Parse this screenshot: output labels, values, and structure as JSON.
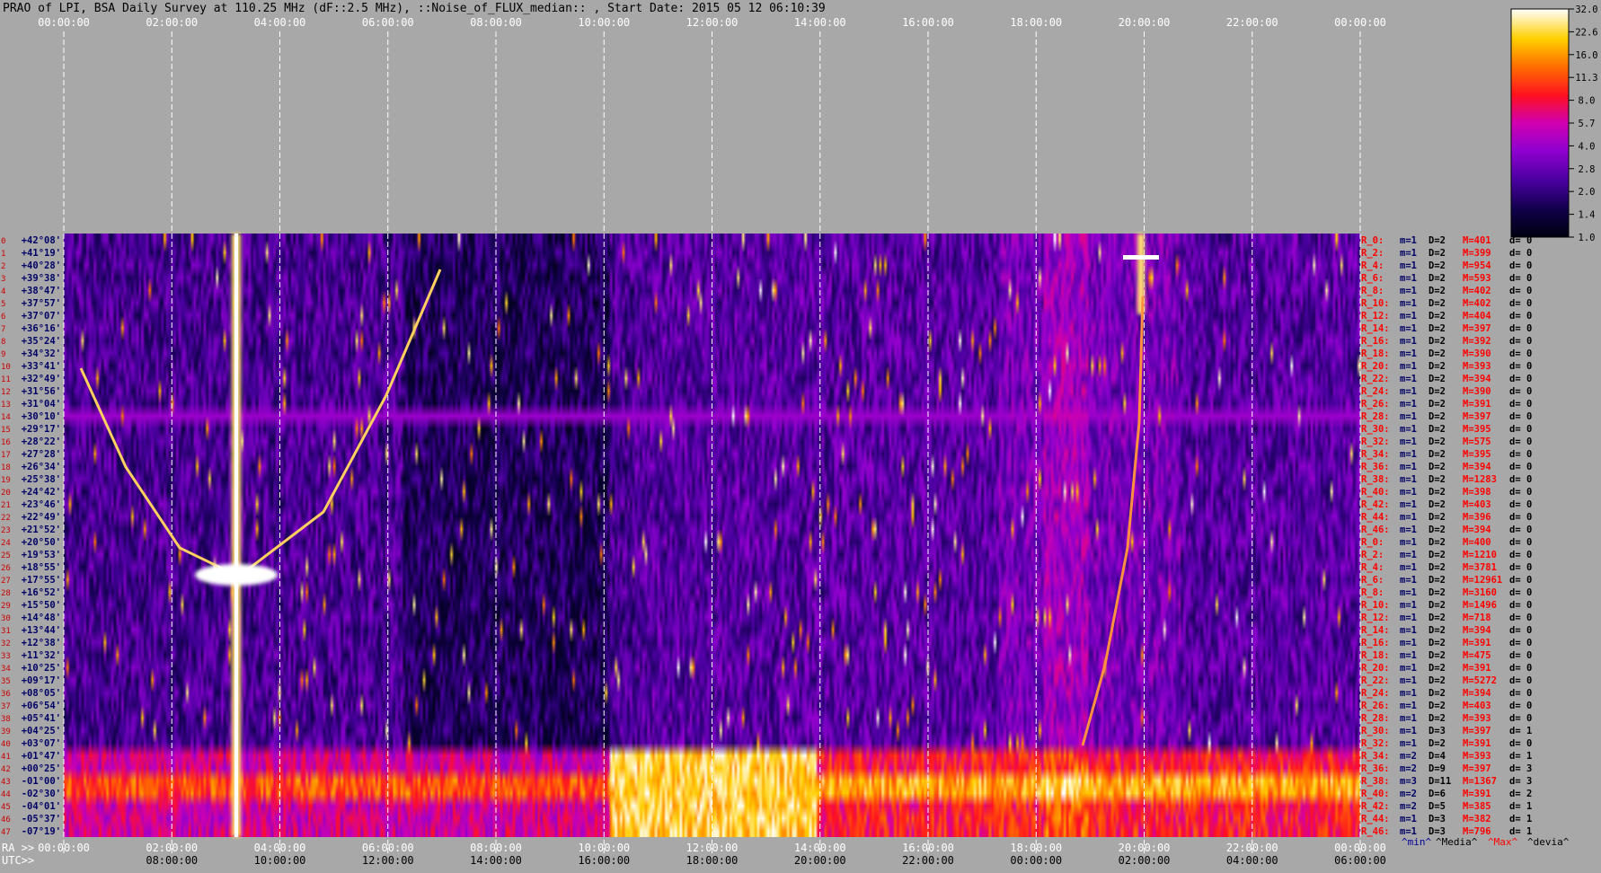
{
  "chart_data": {
    "type": "heatmap",
    "title": "PRAO of LPI, BSA Daily Survey at 110.25 MHz (dF::2.5 MHz), ::Noise_of_FLUX_median:: , Start Date: 2015 05 12 06:10:39",
    "top_time_labels": [
      "00:00:00",
      "02:00:00",
      "04:00:00",
      "06:00:00",
      "08:00:00",
      "10:00:00",
      "12:00:00",
      "14:00:00",
      "16:00:00",
      "18:00:00",
      "20:00:00",
      "22:00:00",
      "00:00:00"
    ],
    "ra_axis_prefix": "RA >>",
    "ra_labels": [
      "00:00:00",
      "02:00:00",
      "04:00:00",
      "06:00:00",
      "08:00:00",
      "10:00:00",
      "12:00:00",
      "14:00:00",
      "16:00:00",
      "18:00:00",
      "20:00:00",
      "22:00:00",
      "00:00:00"
    ],
    "utc_axis_prefix": "UTC>>",
    "utc_labels": [
      "08:00:00",
      "10:00:00",
      "12:00:00",
      "14:00:00",
      "16:00:00",
      "18:00:00",
      "20:00:00",
      "22:00:00",
      "00:00:00",
      "02:00:00",
      "04:00:00",
      "06:00:00"
    ],
    "declinations": [
      "+42°08'",
      "+41°19'",
      "+40°28'",
      "+39°38'",
      "+38°47'",
      "+37°57'",
      "+37°07'",
      "+36°16'",
      "+35°24'",
      "+34°32'",
      "+33°41'",
      "+32°49'",
      "+31°56'",
      "+31°04'",
      "+30°10'",
      "+29°17'",
      "+28°22'",
      "+27°28'",
      "+26°34'",
      "+25°38'",
      "+24°42'",
      "+23°46'",
      "+22°49'",
      "+21°52'",
      "+20°50'",
      "+19°53'",
      "+18°55'",
      "+17°55'",
      "+16°52'",
      "+15°50'",
      "+14°48'",
      "+13°44'",
      "+12°38'",
      "+11°32'",
      "+10°25'",
      "+09°17'",
      "+08°05'",
      "+06°54'",
      "+05°41'",
      "+04°25'",
      "+03°07'",
      "+01°47'",
      "+00°25'",
      "-01°00'",
      "-02°30'",
      "-04°01'",
      "-05°37'",
      "-07°19'"
    ],
    "row_numbers": [
      "0",
      "1",
      "2",
      "3",
      "4",
      "5",
      "6",
      "7",
      "8",
      "9",
      "10",
      "11",
      "12",
      "13",
      "14",
      "15",
      "16",
      "17",
      "18",
      "19",
      "20",
      "21",
      "22",
      "23",
      "24",
      "25",
      "26",
      "27",
      "28",
      "29",
      "30",
      "31",
      "32",
      "33",
      "34",
      "35",
      "36",
      "37",
      "38",
      "39",
      "40",
      "41",
      "42",
      "43",
      "44",
      "45",
      "46",
      "47"
    ],
    "row_stats": [
      {
        "r": "R_0:",
        "m": "m=1",
        "D": "D=2",
        "M": "M=401",
        "d": "d= 0"
      },
      {
        "r": "R_2:",
        "m": "m=1",
        "D": "D=2",
        "M": "M=399",
        "d": "d= 0"
      },
      {
        "r": "R_4:",
        "m": "m=1",
        "D": "D=2",
        "M": "M=954",
        "d": "d= 0"
      },
      {
        "r": "R_6:",
        "m": "m=1",
        "D": "D=2",
        "M": "M=593",
        "d": "d= 0"
      },
      {
        "r": "R_8:",
        "m": "m=1",
        "D": "D=2",
        "M": "M=402",
        "d": "d= 0"
      },
      {
        "r": "R_10:",
        "m": "m=1",
        "D": "D=2",
        "M": "M=402",
        "d": "d= 0"
      },
      {
        "r": "R_12:",
        "m": "m=1",
        "D": "D=2",
        "M": "M=404",
        "d": "d= 0"
      },
      {
        "r": "R_14:",
        "m": "m=1",
        "D": "D=2",
        "M": "M=397",
        "d": "d= 0"
      },
      {
        "r": "R_16:",
        "m": "m=1",
        "D": "D=2",
        "M": "M=392",
        "d": "d= 0"
      },
      {
        "r": "R_18:",
        "m": "m=1",
        "D": "D=2",
        "M": "M=390",
        "d": "d= 0"
      },
      {
        "r": "R_20:",
        "m": "m=1",
        "D": "D=2",
        "M": "M=393",
        "d": "d= 0"
      },
      {
        "r": "R_22:",
        "m": "m=1",
        "D": "D=2",
        "M": "M=394",
        "d": "d= 0"
      },
      {
        "r": "R_24:",
        "m": "m=1",
        "D": "D=2",
        "M": "M=390",
        "d": "d= 0"
      },
      {
        "r": "R_26:",
        "m": "m=1",
        "D": "D=2",
        "M": "M=391",
        "d": "d= 0"
      },
      {
        "r": "R_28:",
        "m": "m=1",
        "D": "D=2",
        "M": "M=397",
        "d": "d= 0"
      },
      {
        "r": "R_30:",
        "m": "m=1",
        "D": "D=2",
        "M": "M=395",
        "d": "d= 0"
      },
      {
        "r": "R_32:",
        "m": "m=1",
        "D": "D=2",
        "M": "M=575",
        "d": "d= 0"
      },
      {
        "r": "R_34:",
        "m": "m=1",
        "D": "D=2",
        "M": "M=395",
        "d": "d= 0"
      },
      {
        "r": "R_36:",
        "m": "m=1",
        "D": "D=2",
        "M": "M=394",
        "d": "d= 0"
      },
      {
        "r": "R_38:",
        "m": "m=1",
        "D": "D=2",
        "M": "M=1283",
        "d": "d= 0"
      },
      {
        "r": "R_40:",
        "m": "m=1",
        "D": "D=2",
        "M": "M=398",
        "d": "d= 0"
      },
      {
        "r": "R_42:",
        "m": "m=1",
        "D": "D=2",
        "M": "M=403",
        "d": "d= 0"
      },
      {
        "r": "R_44:",
        "m": "m=1",
        "D": "D=2",
        "M": "M=396",
        "d": "d= 0"
      },
      {
        "r": "R_46:",
        "m": "m=1",
        "D": "D=2",
        "M": "M=394",
        "d": "d= 0"
      },
      {
        "r": "R_0:",
        "m": "m=1",
        "D": "D=2",
        "M": "M=400",
        "d": "d= 0"
      },
      {
        "r": "R_2:",
        "m": "m=1",
        "D": "D=2",
        "M": "M=1210",
        "d": "d= 0"
      },
      {
        "r": "R_4:",
        "m": "m=1",
        "D": "D=2",
        "M": "M=3781",
        "d": "d= 0"
      },
      {
        "r": "R_6:",
        "m": "m=1",
        "D": "D=2",
        "M": "M=12961",
        "d": "d= 0"
      },
      {
        "r": "R_8:",
        "m": "m=1",
        "D": "D=2",
        "M": "M=3160",
        "d": "d= 0"
      },
      {
        "r": "R_10:",
        "m": "m=1",
        "D": "D=2",
        "M": "M=1496",
        "d": "d= 0"
      },
      {
        "r": "R_12:",
        "m": "m=1",
        "D": "D=2",
        "M": "M=718",
        "d": "d= 0"
      },
      {
        "r": "R_14:",
        "m": "m=1",
        "D": "D=2",
        "M": "M=394",
        "d": "d= 0"
      },
      {
        "r": "R_16:",
        "m": "m=1",
        "D": "D=2",
        "M": "M=391",
        "d": "d= 0"
      },
      {
        "r": "R_18:",
        "m": "m=1",
        "D": "D=2",
        "M": "M=475",
        "d": "d= 0"
      },
      {
        "r": "R_20:",
        "m": "m=1",
        "D": "D=2",
        "M": "M=391",
        "d": "d= 0"
      },
      {
        "r": "R_22:",
        "m": "m=1",
        "D": "D=2",
        "M": "M=5272",
        "d": "d= 0"
      },
      {
        "r": "R_24:",
        "m": "m=1",
        "D": "D=2",
        "M": "M=394",
        "d": "d= 0"
      },
      {
        "r": "R_26:",
        "m": "m=1",
        "D": "D=2",
        "M": "M=403",
        "d": "d= 0"
      },
      {
        "r": "R_28:",
        "m": "m=1",
        "D": "D=2",
        "M": "M=393",
        "d": "d= 0"
      },
      {
        "r": "R_30:",
        "m": "m=1",
        "D": "D=3",
        "M": "M=397",
        "d": "d= 1"
      },
      {
        "r": "R_32:",
        "m": "m=1",
        "D": "D=2",
        "M": "M=391",
        "d": "d= 0"
      },
      {
        "r": "R_34:",
        "m": "m=2",
        "D": "D=4",
        "M": "M=393",
        "d": "d= 1"
      },
      {
        "r": "R_36:",
        "m": "m=2",
        "D": "D=9",
        "M": "M=397",
        "d": "d= 3"
      },
      {
        "r": "R_38:",
        "m": "m=3",
        "D": "D=11",
        "M": "M=1367",
        "d": "d= 3"
      },
      {
        "r": "R_40:",
        "m": "m=2",
        "D": "D=6",
        "M": "M=391",
        "d": "d= 2"
      },
      {
        "r": "R_42:",
        "m": "m=2",
        "D": "D=5",
        "M": "M=385",
        "d": "d= 1"
      },
      {
        "r": "R_44:",
        "m": "m=1",
        "D": "D=3",
        "M": "M=382",
        "d": "d= 1"
      },
      {
        "r": "R_46:",
        "m": "m=1",
        "D": "D=3",
        "M": "M=796",
        "d": "d= 1"
      }
    ],
    "stat_footer": {
      "min": "^min^",
      "median": "^Media^",
      "max": "^Max^",
      "devia": "^devia^"
    },
    "colorbar": {
      "ticks": [
        "32.0",
        "22.6",
        "16.0",
        "11.3",
        "8.0",
        "5.7",
        "4.0",
        "2.8",
        "2.0",
        "1.4",
        "1.0"
      ],
      "scale": "log"
    },
    "colors": {
      "background": "#a8a8a8",
      "stat_label": "#ff0000",
      "stat_dark": "#000066",
      "decl_label": "#000066",
      "row_number": "#cc0000",
      "footer_min": "#000099",
      "footer_max": "#ff0000"
    }
  }
}
